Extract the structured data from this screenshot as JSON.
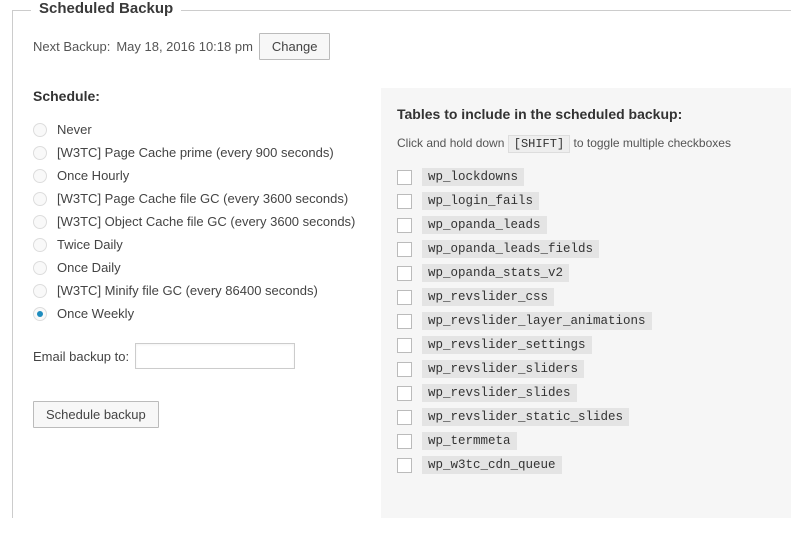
{
  "title": "Scheduled Backup",
  "next_backup_label": "Next Backup:",
  "next_backup_value": "May 18, 2016 10:18 pm",
  "change_btn": "Change",
  "schedule": {
    "heading": "Schedule:",
    "selected_index": 8,
    "options": [
      "Never",
      "[W3TC] Page Cache prime (every 900 seconds)",
      "Once Hourly",
      "[W3TC] Page Cache file GC (every 3600 seconds)",
      "[W3TC] Object Cache file GC (every 3600 seconds)",
      "Twice Daily",
      "Once Daily",
      "[W3TC] Minify file GC (every 86400 seconds)",
      "Once Weekly"
    ]
  },
  "email_label": "Email backup to:",
  "email_value": "",
  "schedule_btn": "Schedule backup",
  "tables": {
    "heading": "Tables to include in the scheduled backup:",
    "hint_pre": "Click and hold down",
    "hint_key": "[SHIFT]",
    "hint_post": "to toggle multiple checkboxes",
    "items": [
      "wp_lockdowns",
      "wp_login_fails",
      "wp_opanda_leads",
      "wp_opanda_leads_fields",
      "wp_opanda_stats_v2",
      "wp_revslider_css",
      "wp_revslider_layer_animations",
      "wp_revslider_settings",
      "wp_revslider_sliders",
      "wp_revslider_slides",
      "wp_revslider_static_slides",
      "wp_termmeta",
      "wp_w3tc_cdn_queue"
    ]
  }
}
